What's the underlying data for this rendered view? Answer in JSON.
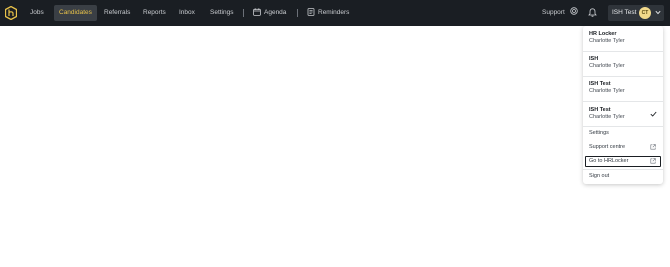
{
  "nav": {
    "items": [
      "Jobs",
      "Candidates",
      "Referrals",
      "Reports",
      "Inbox",
      "Settings"
    ],
    "active": "Candidates",
    "agenda": "Agenda",
    "reminders": "Reminders",
    "support": "Support",
    "account_name": "ISH Test",
    "avatar_initials": "CT",
    "accent": "#e8c24a",
    "bg": "#1a1e23"
  },
  "menu": {
    "accounts": [
      {
        "org": "HR Locker",
        "user": "Charlotte Tyler"
      },
      {
        "org": "ISH",
        "user": "Charlotte Tyler"
      },
      {
        "org": "ISH Test",
        "user": "Charlotte Tyler"
      },
      {
        "org": "ISH Test",
        "user": "Charlotte Tyler",
        "selected": true
      }
    ],
    "settings": "Settings",
    "support_centre": "Support centre",
    "go_to_hrlocker": "Go to HRLocker",
    "sign_out": "Sign out"
  }
}
